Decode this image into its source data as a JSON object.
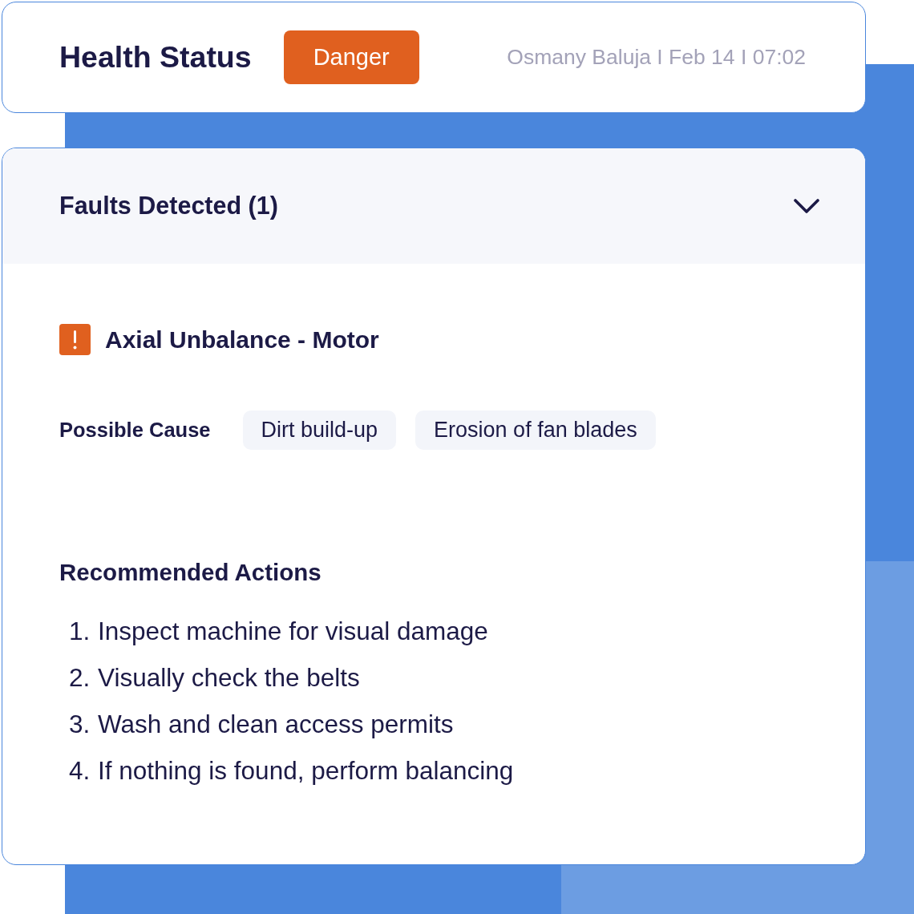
{
  "header": {
    "title": "Health Status",
    "status": {
      "label": "Danger",
      "color": "#e0601f"
    },
    "meta": "Osmany Baluja I Feb 14 I 07:02"
  },
  "faults_panel": {
    "title": "Faults Detected (1)",
    "expanded": true,
    "faults": [
      {
        "title": "Axial Unbalance - Motor",
        "color": "#e0601f",
        "cause_label": "Possible Cause",
        "causes": [
          "Dirt build-up",
          "Erosion of fan blades"
        ]
      }
    ],
    "actions_title": "Recommended Actions",
    "actions": [
      {
        "number": "1.",
        "text": "Inspect machine for visual damage"
      },
      {
        "number": "2.",
        "text": "Visually check the belts"
      },
      {
        "number": "3.",
        "text": "Wash and clean access permits"
      },
      {
        "number": "4.",
        "text": "If nothing is found, perform balancing"
      }
    ]
  }
}
